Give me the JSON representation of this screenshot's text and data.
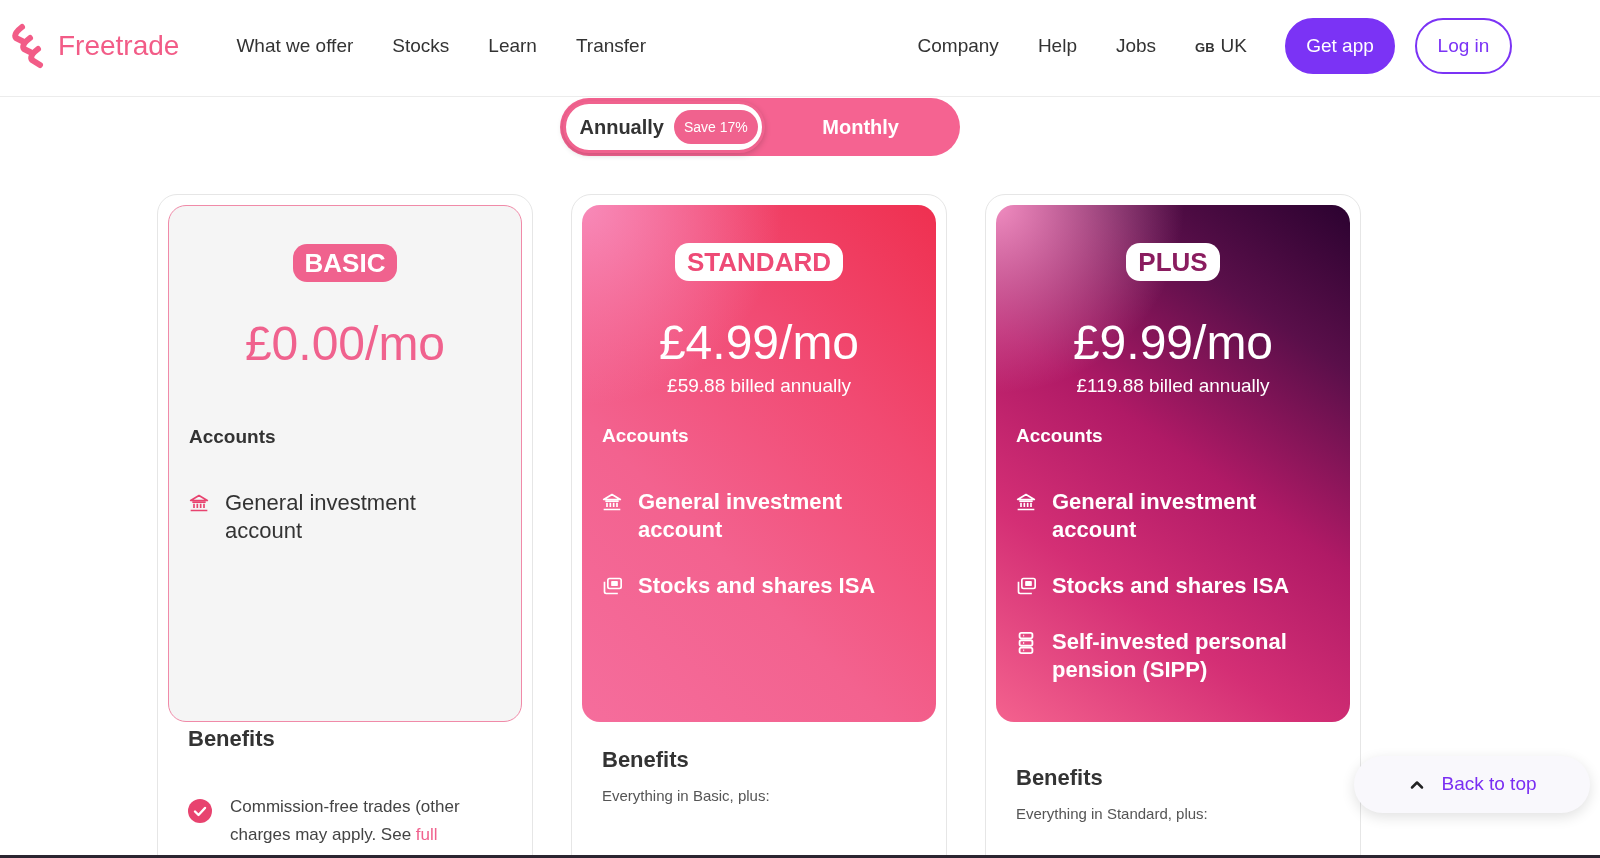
{
  "header": {
    "logo": "Freetrade",
    "nav_left": [
      "What we offer",
      "Stocks",
      "Learn",
      "Transfer"
    ],
    "nav_right": [
      "Company",
      "Help",
      "Jobs"
    ],
    "region": {
      "code": "GB",
      "label": "UK"
    },
    "buttons": [
      {
        "label": "Get app",
        "kind": "primary"
      },
      {
        "label": "Log in",
        "kind": "outline"
      }
    ]
  },
  "billing_toggle": [
    {
      "label": "Annually",
      "badge": "Save 17%",
      "selected": true
    },
    {
      "label": "Monthly",
      "selected": false
    }
  ],
  "plans": [
    {
      "kind": "plain",
      "badge": "BASIC",
      "price": "£0.00/mo",
      "accounts_heading": "Accounts",
      "accounts": [
        {
          "kind": "general",
          "label": "General investment account"
        }
      ],
      "benefits_heading": "Benefits",
      "benefits": [
        {
          "text": "Commission-free trades (other charges may apply. See",
          "link": "full"
        }
      ]
    },
    {
      "kind": "bright",
      "badge": "STANDARD",
      "price": "£4.99/mo",
      "billing": "£59.88 billed annually",
      "accounts_heading": "Accounts",
      "accounts": [
        {
          "kind": "general",
          "label": "General investment account"
        },
        {
          "kind": "isa",
          "label": "Stocks and shares ISA"
        }
      ],
      "benefits_heading": "Benefits",
      "benefits_intro": "Everything in Basic, plus:"
    },
    {
      "kind": "deep",
      "badge": "PLUS",
      "price": "£9.99/mo",
      "billing": "£119.88 billed annually",
      "accounts_heading": "Accounts",
      "accounts": [
        {
          "kind": "general",
          "label": "General investment account"
        },
        {
          "kind": "isa",
          "label": "Stocks and shares ISA"
        },
        {
          "kind": "pension",
          "label": "Self-invested personal pension (SIPP)"
        }
      ],
      "benefits_heading": "Benefits",
      "benefits_intro": "Everything in Standard, plus:"
    }
  ],
  "back_to_top": "Back to top"
}
